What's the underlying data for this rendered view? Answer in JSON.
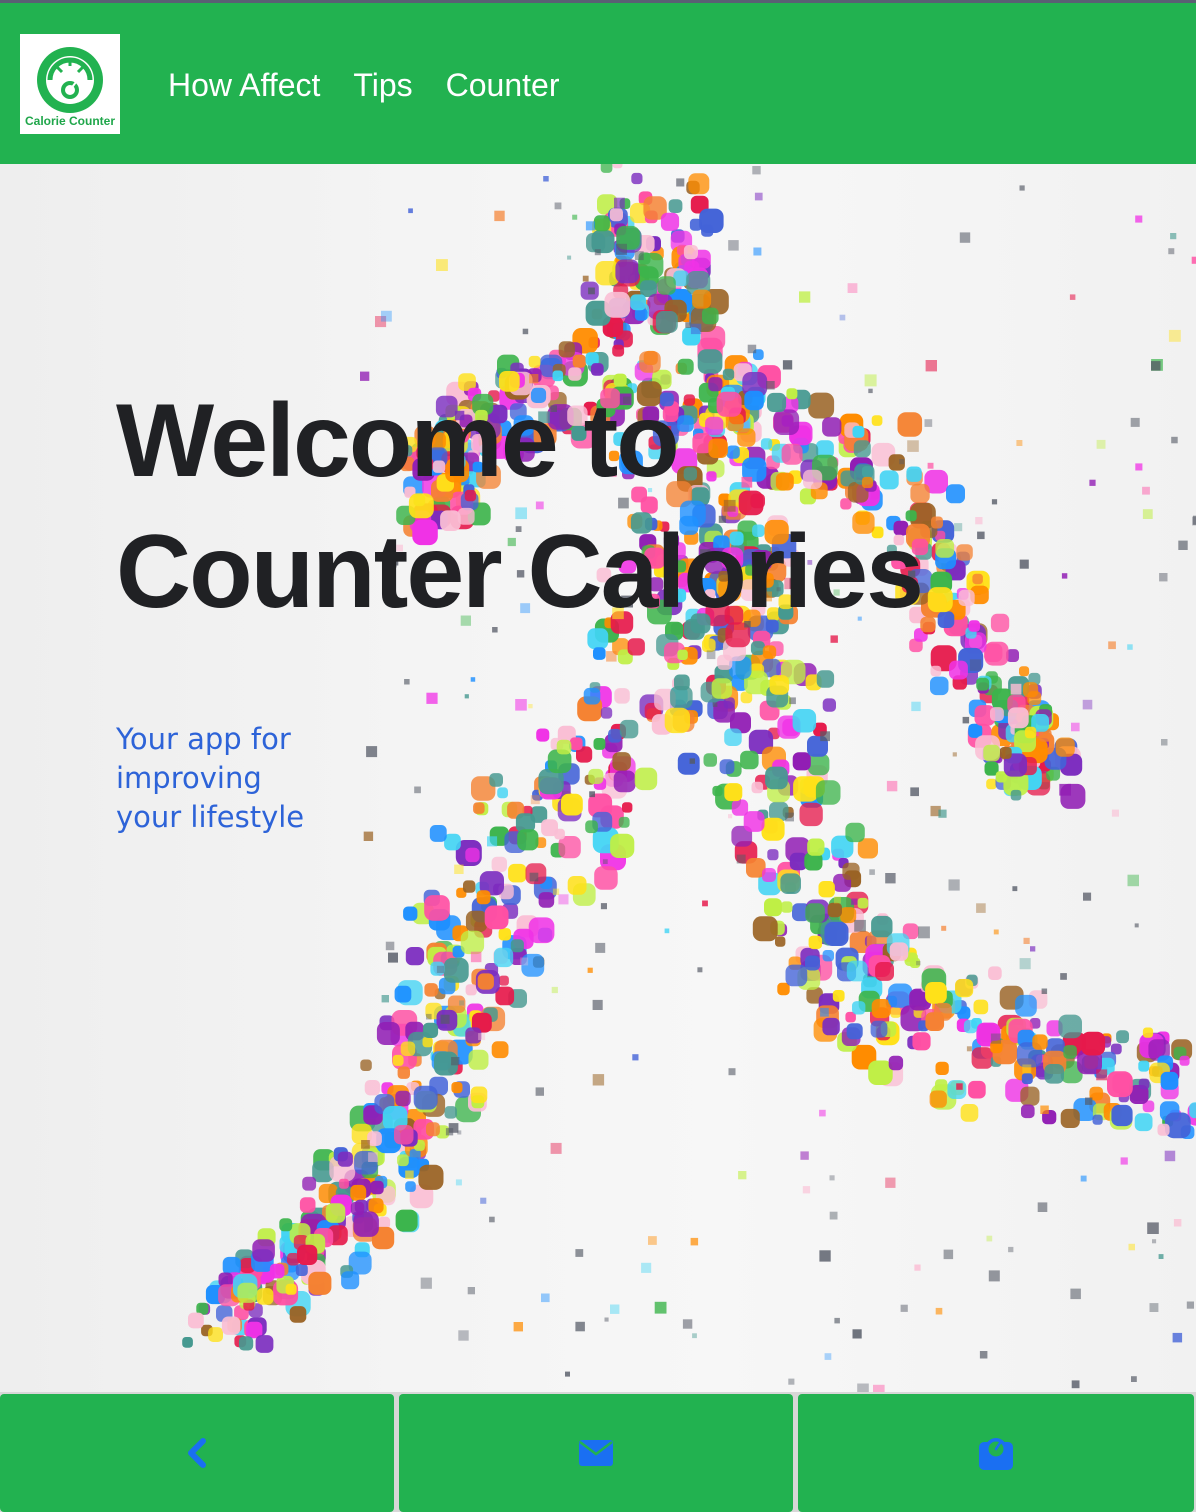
{
  "header": {
    "logo_text": "Calorie Counter",
    "logo_icon": "speedometer-icon",
    "nav": [
      {
        "label": "How Affect"
      },
      {
        "label": "Tips"
      },
      {
        "label": "Counter"
      }
    ]
  },
  "hero": {
    "title_line1": "Welcome to",
    "title_line2": "Counter Calories",
    "subtitle_line1": "Your app for improving",
    "subtitle_line2": "your lifestyle",
    "background_image": "colorful-dotted-runner-illustration"
  },
  "bottom_nav": {
    "back_icon": "chevron-left-icon",
    "mail_icon": "envelope-icon",
    "calc_icon": "scale-icon"
  },
  "colors": {
    "brand_green": "#22b250",
    "title_text": "#202124",
    "subtitle_text": "#2d63d8",
    "icon_blue": "#1a6ff2"
  }
}
